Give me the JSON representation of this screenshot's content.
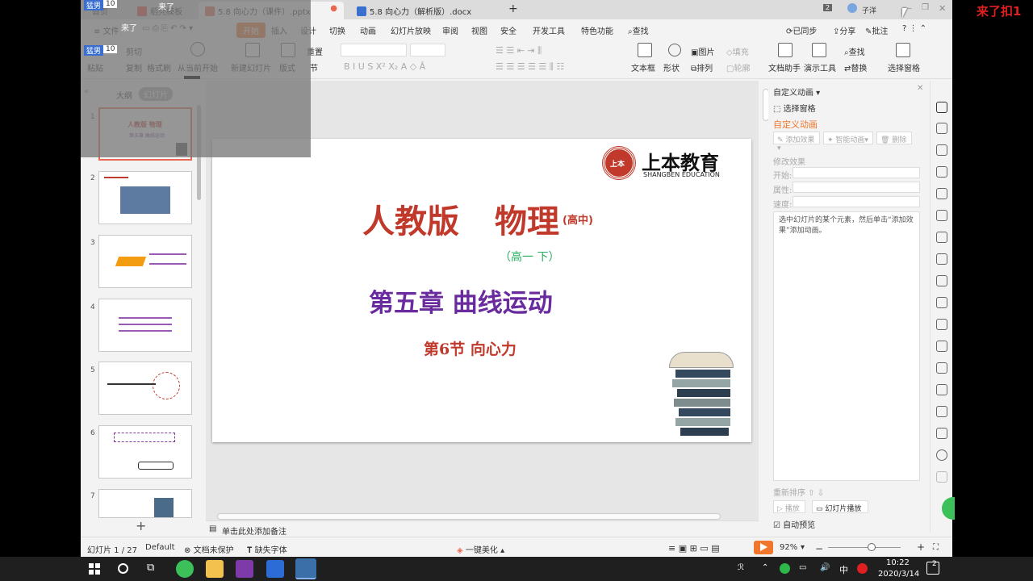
{
  "overlay_top_right": "来了扣1",
  "overlay_left_text": "来了",
  "overlay_badges": [
    "猛男",
    "10"
  ],
  "tabs": [
    {
      "label": "首页",
      "color": "#888"
    },
    {
      "label": "稻壳模板",
      "color": "#e74c3c"
    },
    {
      "label": "5.8 向心力（课件）.pptx",
      "color": "#e8694f"
    },
    {
      "label": "5.8 向心力（解析版）.docx",
      "color": "#3a6fcf"
    }
  ],
  "tab_add": "+",
  "user_name": "子洋",
  "page_badge": "2",
  "menu": {
    "file": "文件",
    "items": [
      "开始",
      "插入",
      "设计",
      "切换",
      "动画",
      "幻灯片放映",
      "审阅",
      "视图",
      "安全",
      "开发工具",
      "特色功能"
    ],
    "search": "查找",
    "right": [
      "已同步",
      "分享",
      "批注"
    ]
  },
  "ribbon": {
    "paste": "粘贴",
    "cut": "剪切",
    "copy": "复制",
    "format_painter": "格式刷",
    "from_current": "从当前开始",
    "new_slide": "新建幻灯片",
    "layout": "版式",
    "section": "节",
    "reset": "重置",
    "textbox": "文本框",
    "shape": "形状",
    "picture": "图片",
    "fill": "填充",
    "arrange": "排列",
    "outline": "轮廓",
    "find": "查找",
    "replace": "替换",
    "doc_helper": "文档助手",
    "present_tool": "演示工具",
    "select_pane": "选择窗格"
  },
  "left_panel": {
    "outline_tab": "大纲",
    "slides_tab": "幻灯片",
    "slide_numbers": [
      "1",
      "2",
      "3",
      "4",
      "5",
      "6",
      "7"
    ],
    "add_button": "+"
  },
  "slide": {
    "logo_cn": "上本教育",
    "logo_en": "SHANGBEN EDUCATION",
    "logo_mark": "上本",
    "title_a": "人教版",
    "title_b": "物理",
    "title_suffix": "(高中)",
    "grade": "（高一  下）",
    "chapter": "第五章  曲线运动",
    "section": "第6节  向心力"
  },
  "notes_placeholder": "单击此处添加备注",
  "anim_pane": {
    "header": "自定义动画",
    "select_pane": "选择窗格",
    "custom_anim": "自定义动画",
    "add_effect": "添加效果",
    "smart_anim": "智能动画",
    "delete": "删除",
    "modify": "修改效果",
    "start": "开始:",
    "property": "属性:",
    "speed": "速度:",
    "hint": "选中幻灯片的某个元素，然后单击“添加效果”添加动画。",
    "reorder": "重新排序",
    "play": "播放",
    "slideshow": "幻灯片播放",
    "auto_preview": "自动预览"
  },
  "status": {
    "slide_info": "幻灯片 1 / 27",
    "theme": "Default",
    "protect": "文档未保护",
    "missing_font": "缺失字体",
    "beautify": "一键美化",
    "zoom": "92%",
    "zoom_level": 0.6
  },
  "taskbar": {
    "time": "10:22",
    "date": "2020/3/14",
    "ime": "中",
    "notif": "2"
  }
}
